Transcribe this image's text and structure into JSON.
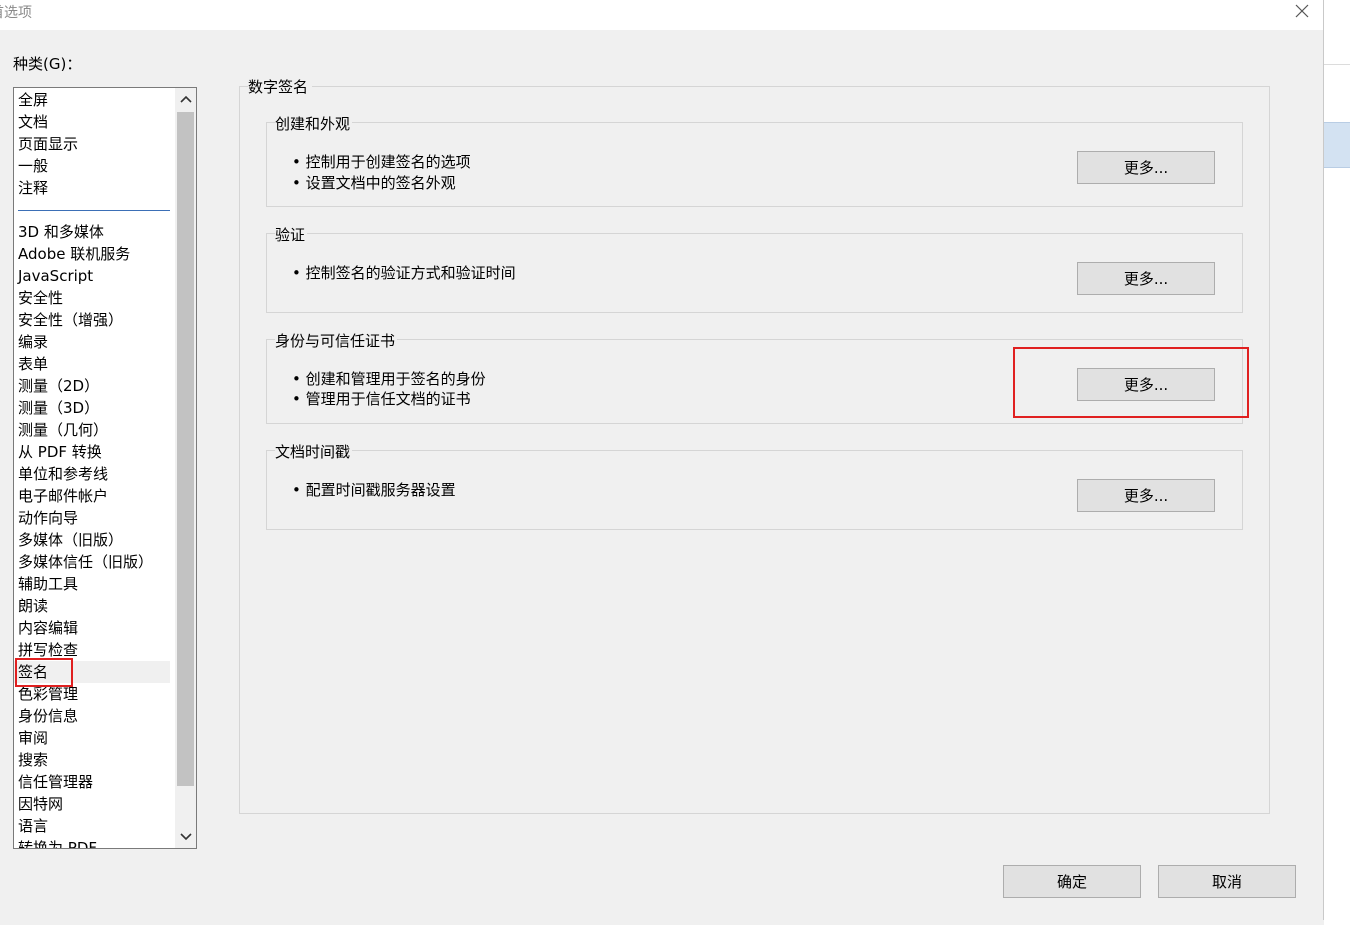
{
  "window": {
    "title": "首选项"
  },
  "categories": {
    "label": "种类(G)：",
    "group1": [
      "全屏",
      "文档",
      "页面显示",
      "一般",
      "注释"
    ],
    "group2": [
      "3D 和多媒体",
      "Adobe 联机服务",
      "JavaScript",
      "安全性",
      "安全性（增强）",
      "编录",
      "表单",
      "测量（2D）",
      "测量（3D）",
      "测量（几何）",
      "从 PDF 转换",
      "单位和参考线",
      "电子邮件帐户",
      "动作向导",
      "多媒体（旧版）",
      "多媒体信任（旧版）",
      "辅助工具",
      "朗读",
      "内容编辑",
      "拼写检查",
      "签名",
      "色彩管理",
      "身份信息",
      "审阅",
      "搜索",
      "信任管理器",
      "因特网",
      "语言",
      "转换为 PDF"
    ],
    "selected": "签名"
  },
  "main": {
    "group_title": "数字签名",
    "sections": [
      {
        "title": "创建和外观",
        "bullets": [
          "• 控制用于创建签名的选项",
          "• 设置文档中的签名外观"
        ],
        "button": "更多..."
      },
      {
        "title": "验证",
        "bullets": [
          "• 控制签名的验证方式和验证时间"
        ],
        "button": "更多..."
      },
      {
        "title": "身份与可信任证书",
        "bullets": [
          "• 创建和管理用于签名的身份",
          "• 管理用于信任文档的证书"
        ],
        "button": "更多..."
      },
      {
        "title": "文档时间戳",
        "bullets": [
          "• 配置时间戳服务器设置"
        ],
        "button": "更多..."
      }
    ]
  },
  "footer": {
    "ok": "确定",
    "cancel": "取消"
  },
  "colors": {
    "annotation_red": "#e02020",
    "separator_blue": "#3b6fb6"
  },
  "icons": {
    "close": "close-icon",
    "scroll_up": "chevron-up-icon",
    "scroll_down": "chevron-down-icon"
  }
}
